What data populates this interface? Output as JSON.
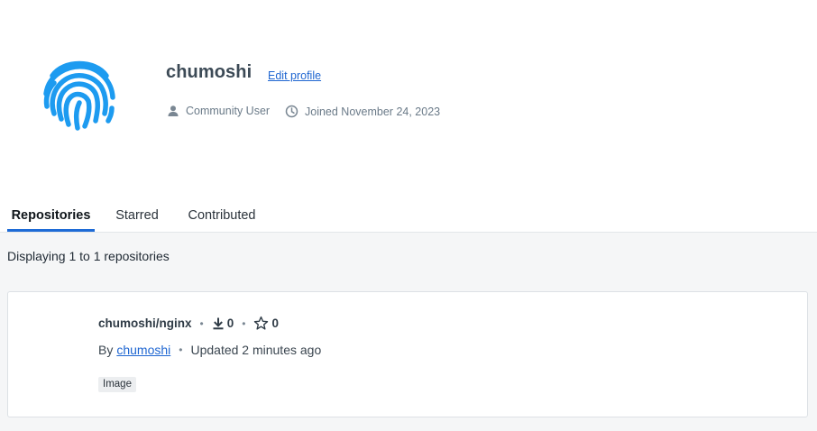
{
  "profile": {
    "username": "chumoshi",
    "edit_label": "Edit profile",
    "role": "Community User",
    "joined": "Joined November 24, 2023",
    "avatar_icon": "fingerprint-icon",
    "avatar_color": "#1d9bf0"
  },
  "tabs": [
    {
      "label": "Repositories",
      "active": true
    },
    {
      "label": "Starred",
      "active": false
    },
    {
      "label": "Contributed",
      "active": false
    }
  ],
  "listing": {
    "summary": "Displaying 1 to 1 repositories"
  },
  "repositories": [
    {
      "name": "chumoshi/nginx",
      "downloads": "0",
      "stars": "0",
      "by_prefix": "By",
      "author": "chumoshi",
      "updated": "Updated 2 minutes ago",
      "badge": "Image"
    }
  ],
  "colors": {
    "accent": "#1e6bd6",
    "link": "#1f66d1"
  }
}
